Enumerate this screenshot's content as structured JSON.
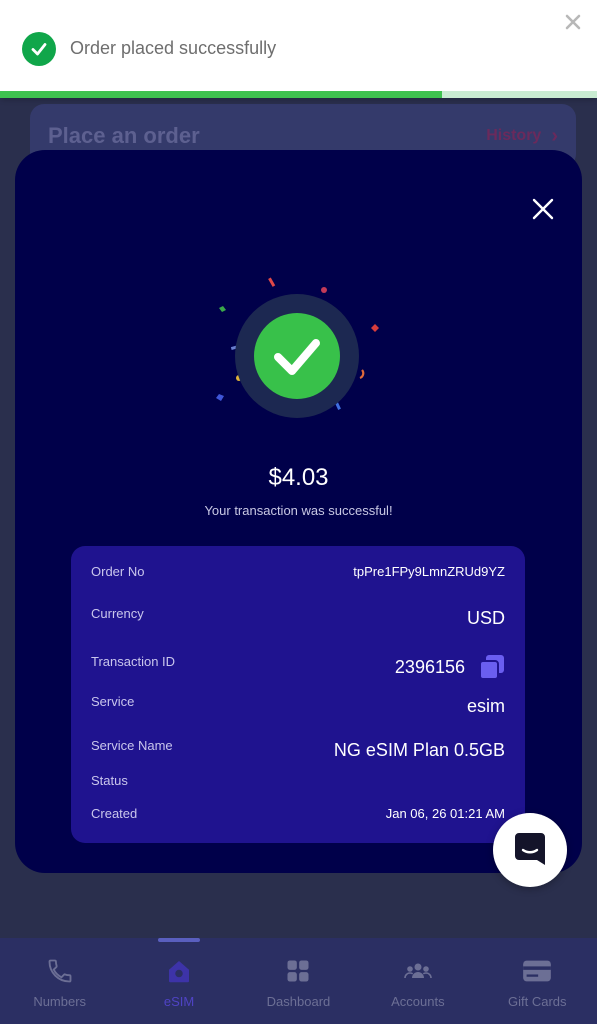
{
  "background": {
    "title": "Place an order",
    "history_label": "History"
  },
  "toast": {
    "message": "Order placed successfully",
    "progress": 0.74
  },
  "modal": {
    "amount": "$4.03",
    "subtitle": "Your transaction was successful!",
    "details": {
      "order_no_label": "Order No",
      "order_no_value": "tpPre1FPy9LmnZRUd9YZ",
      "currency_label": "Currency",
      "currency_value": "USD",
      "transaction_id_label": "Transaction ID",
      "transaction_id_value": "2396156",
      "service_label": "Service",
      "service_value": "esim",
      "service_name_label": "Service Name",
      "service_name_value": "NG eSIM Plan 0.5GB",
      "status_label": "Status",
      "status_value": "",
      "created_label": "Created",
      "created_value": "Jan 06, 26 01:21 AM"
    }
  },
  "bottom_nav": {
    "items": [
      {
        "label": "Numbers",
        "icon": "phone-icon"
      },
      {
        "label": "eSIM",
        "icon": "esim-icon"
      },
      {
        "label": "Dashboard",
        "icon": "grid-icon"
      },
      {
        "label": "Accounts",
        "icon": "accounts-icon"
      },
      {
        "label": "Gift Cards",
        "icon": "gift-card-icon"
      }
    ],
    "active_index": 1
  },
  "colors": {
    "modal_bg": "#00004a",
    "card_bg": "#1f138f",
    "success_green": "#38c14a",
    "accent": "#4f43c4"
  }
}
